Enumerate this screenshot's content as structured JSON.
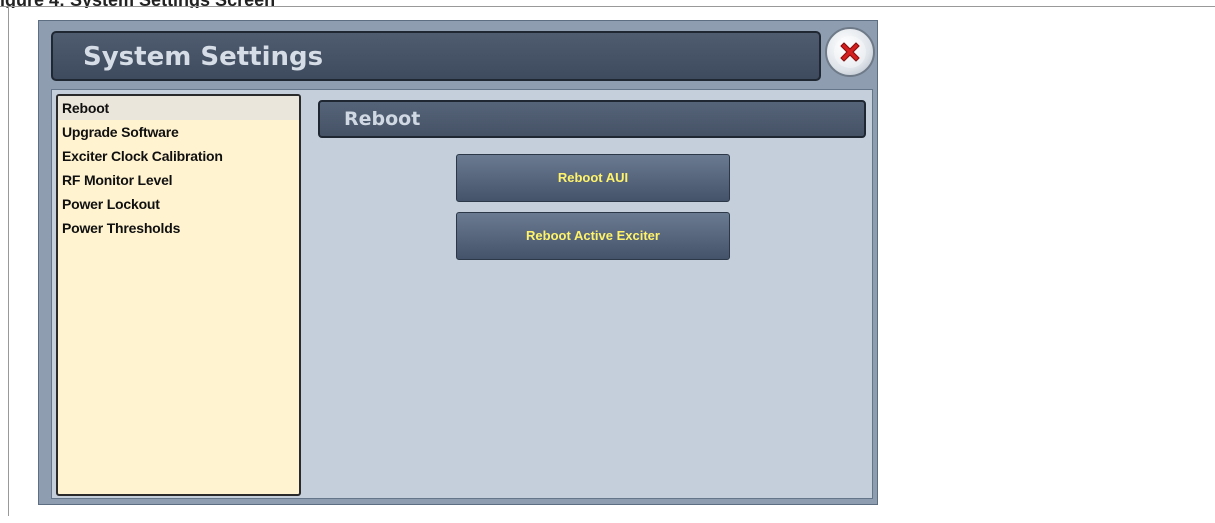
{
  "caption": "igure 4: System Settings Screen",
  "window": {
    "title": "System Settings",
    "close_icon": "close-x-icon",
    "accent_color": "#d62020"
  },
  "menu": {
    "items": [
      {
        "label": "Reboot",
        "selected": true
      },
      {
        "label": "Upgrade Software",
        "selected": false
      },
      {
        "label": "Exciter Clock Calibration",
        "selected": false
      },
      {
        "label": "RF Monitor Level",
        "selected": false
      },
      {
        "label": "Power Lockout",
        "selected": false
      },
      {
        "label": "Power Thresholds",
        "selected": false
      }
    ]
  },
  "section": {
    "title": "Reboot",
    "buttons": [
      {
        "label": "Reboot AUI"
      },
      {
        "label": "Reboot Active Exciter"
      }
    ]
  }
}
